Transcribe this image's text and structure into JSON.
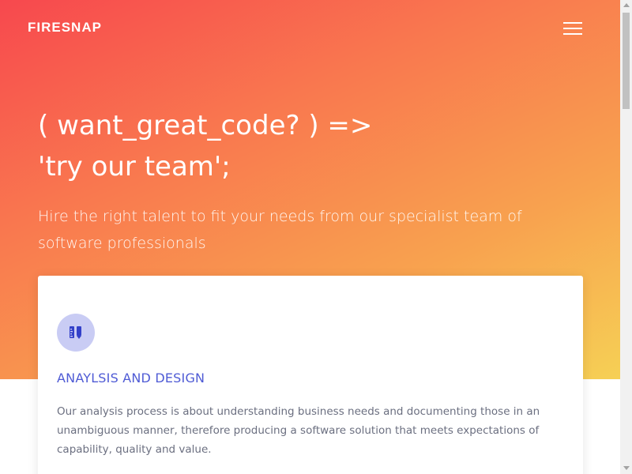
{
  "header": {
    "logo": "FIRESNAP",
    "menu_icon": "hamburger-menu-icon"
  },
  "hero": {
    "headline_line1": "( want_great_code? ) =>",
    "headline_line2": "'try our team';",
    "subtitle": "Hire the right talent to fit your needs from our specialist team of software professionals",
    "gradient_colors": [
      "#f7484e",
      "#f9784f",
      "#f8a34f",
      "#f6d055"
    ]
  },
  "card": {
    "icon": "design-tools-icon",
    "title": "ANAYLSIS AND DESIGN",
    "description": "Our analysis process is about understanding business needs and documenting those in an unambiguous manner, therefore producing a software solution that meets expectations of capability, quality and value.",
    "accent_color": "#4f5bd5",
    "icon_bg_color": "#c9ccf4"
  }
}
